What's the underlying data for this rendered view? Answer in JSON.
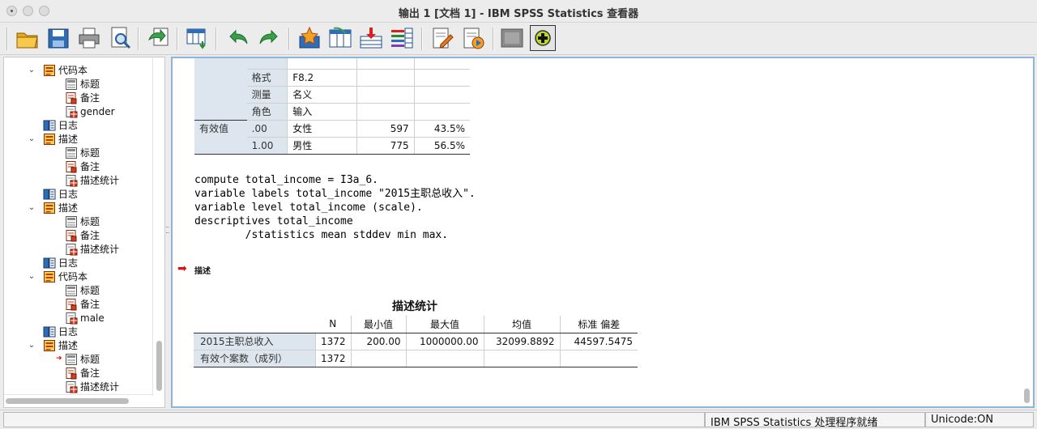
{
  "window": {
    "title": "输出 1 [文档 1] - IBM SPSS Statistics 查看器"
  },
  "toolbar": {
    "buttons": [
      "open-folder",
      "save",
      "print",
      "print-preview",
      "export",
      "go-to-data",
      "undo",
      "redo",
      "insert-bookmark",
      "insert-heading",
      "insert-title",
      "insert-text",
      "insert-page-break",
      "create-edit-autoscript",
      "run-script",
      "designate-window",
      "add-item"
    ]
  },
  "nav": {
    "items": [
      {
        "label": "代码本",
        "icon": "book",
        "level": 1,
        "toggle": "⌄"
      },
      {
        "label": "标题",
        "icon": "title",
        "level": 2
      },
      {
        "label": "备注",
        "icon": "note",
        "level": 2
      },
      {
        "label": "gender",
        "icon": "table",
        "level": 2
      },
      {
        "label": "日志",
        "icon": "log",
        "level": 1
      },
      {
        "label": "描述",
        "icon": "book",
        "level": 1,
        "toggle": "⌄"
      },
      {
        "label": "标题",
        "icon": "title",
        "level": 2
      },
      {
        "label": "备注",
        "icon": "note",
        "level": 2
      },
      {
        "label": "描述统计",
        "icon": "table",
        "level": 2
      },
      {
        "label": "日志",
        "icon": "log",
        "level": 1
      },
      {
        "label": "描述",
        "icon": "book",
        "level": 1,
        "toggle": "⌄"
      },
      {
        "label": "标题",
        "icon": "title",
        "level": 2
      },
      {
        "label": "备注",
        "icon": "note",
        "level": 2
      },
      {
        "label": "描述统计",
        "icon": "table",
        "level": 2
      },
      {
        "label": "日志",
        "icon": "log",
        "level": 1
      },
      {
        "label": "代码本",
        "icon": "book",
        "level": 1,
        "toggle": "⌄"
      },
      {
        "label": "标题",
        "icon": "title",
        "level": 2
      },
      {
        "label": "备注",
        "icon": "note",
        "level": 2
      },
      {
        "label": "male",
        "icon": "table",
        "level": 2
      },
      {
        "label": "日志",
        "icon": "log",
        "level": 1
      },
      {
        "label": "描述",
        "icon": "book",
        "level": 1,
        "toggle": "⌄"
      },
      {
        "label": "标题",
        "icon": "title",
        "level": 2,
        "arrow": true
      },
      {
        "label": "备注",
        "icon": "note",
        "level": 2
      },
      {
        "label": "描述统计",
        "icon": "table",
        "level": 2
      }
    ]
  },
  "codebook": {
    "rows": [
      {
        "group": "",
        "name": "",
        "value": "",
        "count": "",
        "percent": ""
      },
      {
        "group": "",
        "name": "格式",
        "value": "F8.2",
        "count": "",
        "percent": ""
      },
      {
        "group": "",
        "name": "测量",
        "value": "名义",
        "count": "",
        "percent": ""
      },
      {
        "group": "",
        "name": "角色",
        "value": "输入",
        "count": "",
        "percent": ""
      },
      {
        "group": "有效值",
        "name": ".00",
        "value": "女性",
        "count": "597",
        "percent": "43.5%"
      },
      {
        "group": "",
        "name": "1.00",
        "value": "男性",
        "count": "775",
        "percent": "56.5%"
      }
    ]
  },
  "syntax": {
    "lines": [
      "compute total_income = I3a_6.",
      "variable labels total_income \"2015主职总收入\".",
      "variable level total_income (scale).",
      "descriptives total_income",
      "        /statistics mean stddev min max."
    ]
  },
  "section": {
    "label": "描述"
  },
  "descriptives": {
    "title": "描述统计",
    "headers": [
      "",
      "N",
      "最小值",
      "最大值",
      "均值",
      "标准 偏差"
    ],
    "rows": [
      {
        "label": "2015主职总收入",
        "n": "1372",
        "min": "200.00",
        "max": "1000000.00",
        "mean": "32099.8892",
        "sd": "44597.5475"
      },
      {
        "label": "有效个案数（成列）",
        "n": "1372",
        "min": "",
        "max": "",
        "mean": "",
        "sd": ""
      }
    ]
  },
  "status": {
    "processor": "IBM SPSS Statistics 处理程序就绪",
    "unicode": "Unicode:ON"
  }
}
